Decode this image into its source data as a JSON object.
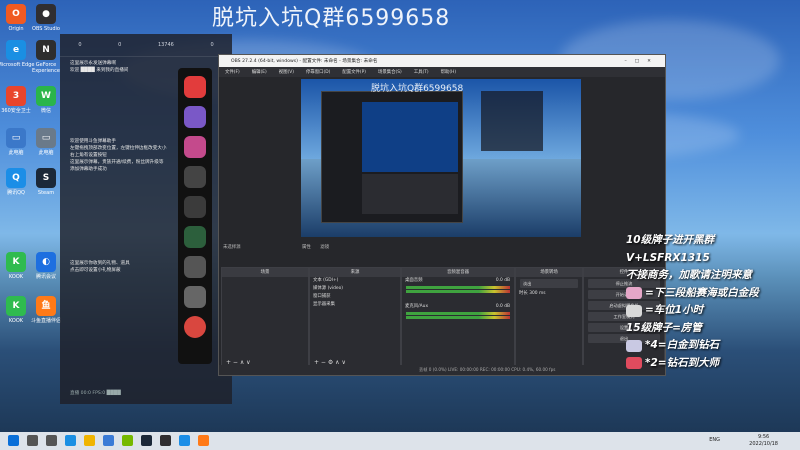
{
  "overlay_banner": "脱坑入坑Q群6599658",
  "desktop_icons": [
    {
      "label": "Origin",
      "color": "#f05a22",
      "glyph": "O",
      "icon": "origin-icon"
    },
    {
      "label": "OBS Studio",
      "color": "#302e31",
      "glyph": "●",
      "icon": "obs-icon"
    },
    {
      "label": "Microsoft Edge",
      "color": "#1a8fe3",
      "glyph": "e",
      "icon": "edge-icon"
    },
    {
      "label": "GeForce Experience",
      "color": "#2e2e2e",
      "glyph": "N",
      "icon": "nvidia-icon"
    },
    {
      "label": "360安全卫士",
      "color": "#e9452c",
      "glyph": "3",
      "icon": "security-icon"
    },
    {
      "label": "微信",
      "color": "#2ab54a",
      "glyph": "W",
      "icon": "wechat-icon"
    },
    {
      "label": "此电脑",
      "color": "#3b78c9",
      "glyph": "▭",
      "icon": "computer-icon"
    },
    {
      "label": "此电脑",
      "color": "#6a7a8a",
      "glyph": "▭",
      "icon": "computer-icon"
    },
    {
      "label": "腾讯QQ",
      "color": "#1b8ee7",
      "glyph": "Q",
      "icon": "qq-icon"
    },
    {
      "label": "Steam",
      "color": "#1b2838",
      "glyph": "S",
      "icon": "steam-icon"
    },
    {
      "label": "KOOK",
      "color": "#2fbb4f",
      "glyph": "K",
      "icon": "kook-icon"
    },
    {
      "label": "腾讯会议",
      "color": "#1d6fe0",
      "glyph": "◐",
      "icon": "meeting-icon"
    },
    {
      "label": "KOOK",
      "color": "#2fbb4f",
      "glyph": "K",
      "icon": "kook-icon"
    },
    {
      "label": "斗鱼直播伴侣",
      "color": "#ff7a18",
      "glyph": "鱼",
      "icon": "douyu-icon"
    }
  ],
  "stream_panel": {
    "header": {
      "a": "0",
      "b": "0",
      "c": "13746",
      "d": "0"
    },
    "messages_1": [
      "这里展示永发送弹幕啊",
      "欢迎 ████ 来到我的直播间"
    ],
    "messages_2": [
      "欢迎使用斗鱼弹幕助手",
      "左键拖拽顶部改变位置，左键拉伸边框改变大小",
      "右上角有设置按钮",
      "这里展示弹幕，贵族开通/续费，粉丝牌升级等",
      "添加弹幕助手成功"
    ],
    "messages_3": [
      "这里展示你收到的礼物、道具",
      "点击即可设置小礼物屏蔽"
    ],
    "footer": "直播 00:0 FPS:0 ████"
  },
  "obs": {
    "title": "OBS 27.2.4 (64-bit, windows) - 配置文件: 未命名 - 场景集合: 未命名",
    "menu": [
      "文件(F)",
      "编辑(E)",
      "视图(V)",
      "停靠窗口(D)",
      "配置文件(P)",
      "场景集合(S)",
      "工具(T)",
      "帮助(H)"
    ],
    "preview_caption": "脱坑入坑Q群6599658",
    "scene_toolbar": [
      "未选择源",
      "属性",
      "滤镜"
    ],
    "docks": {
      "scenes": "场景",
      "sources": "来源",
      "mixer": "音频混音器",
      "transitions": "场景转场",
      "controls": "控件"
    },
    "sources": [
      "文本 (GDI+)",
      "媒体源 (video)",
      "窗口捕获",
      "显示器采集"
    ],
    "mixer": [
      {
        "name": "桌面音频",
        "level": "0.0 dB"
      },
      {
        "name": "麦克风/Aux",
        "level": "0.0 dB"
      }
    ],
    "transition": {
      "type": "淡出",
      "duration_label": "时长",
      "duration": "300 ms"
    },
    "controls": [
      "停止推流",
      "开始录制",
      "启动虚拟摄像机",
      "工作室模式",
      "设置",
      "退出"
    ],
    "status": "丢帧 0 (0.0%)    LIVE: 00:00:00    REC: 00:00:00    CPU: 0.4%, 60.00 fps"
  },
  "rules": {
    "line1": "10级牌子进开黑群",
    "line2": "V+LSFRX1315",
    "line3": "不接商务，加歌请注明来意",
    "tiers": [
      {
        "text": "=下三段船赛海或白金段",
        "badge": "#e5a7c8"
      },
      {
        "text": "=车位1小时",
        "badge": "#d9d9d9"
      },
      {
        "text": "15级牌子=房管",
        "badge": ""
      },
      {
        "text": "*4=白金到钻石",
        "badge": "#c9c9e3"
      },
      {
        "text": "*2=钻石到大师",
        "badge": "#e04b5e"
      }
    ]
  },
  "taskbar": {
    "time": "9:56",
    "date": "2022/10/18",
    "lang": "ENG",
    "icons": [
      "start-icon",
      "search-icon",
      "taskview-icon",
      "edge-icon",
      "explorer-icon",
      "store-icon",
      "nvidia-icon",
      "steam-icon",
      "obs-icon",
      "qq-icon",
      "douyu-icon"
    ]
  }
}
